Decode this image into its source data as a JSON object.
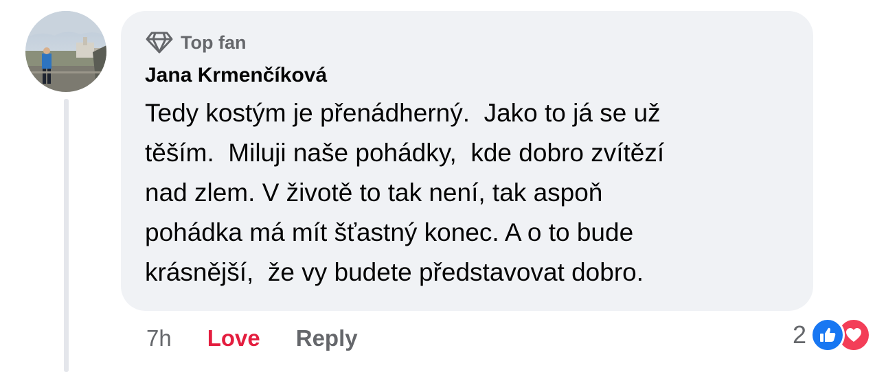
{
  "comment": {
    "badge_label": "Top fan",
    "badge_icon": "diamond-icon",
    "author": "Jana Krmenčíková",
    "text": "Tedy kostým je přenádherný.  Jako to já se už\ntěším.  Miluji naše pohádky,  kde dobro zvítězí\nnad zlem. V životě to tak není, tak aspoň\npohádka má mít šťastný konec. A o to bude\nkrásnější,  že vy budete představovat dobro.",
    "time": "7h",
    "love_label": "Love",
    "reply_label": "Reply",
    "reaction_count": "2",
    "reactions": [
      "like-icon",
      "heart-icon"
    ]
  },
  "colors": {
    "bubble_bg": "#f0f2f5",
    "love": "#e41e3f",
    "secondary_text": "#65676b",
    "like_blue": "#1877f2",
    "heart_red": "#f33e58"
  }
}
